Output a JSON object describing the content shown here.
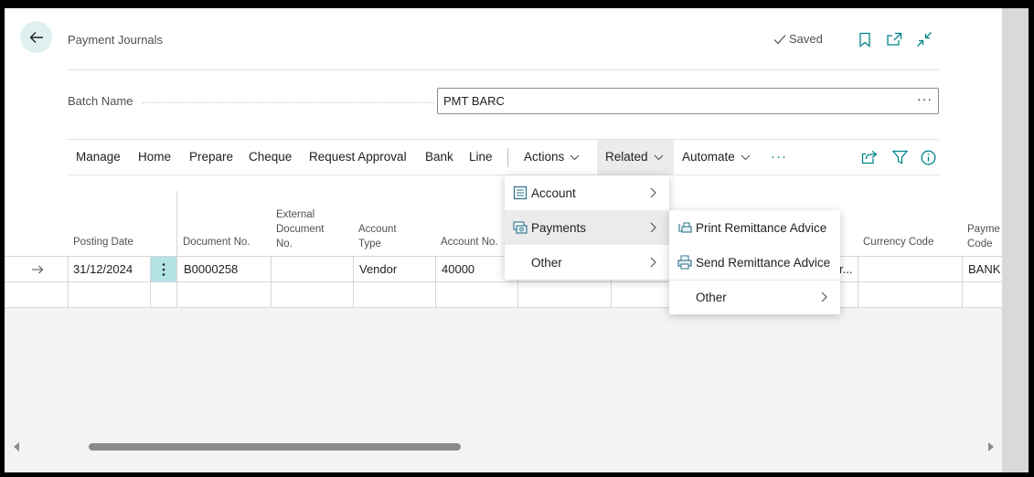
{
  "header": {
    "title": "Payment Journals",
    "saved_label": "Saved"
  },
  "batch": {
    "label": "Batch Name",
    "value": "PMT BARC",
    "more": "···"
  },
  "action_bar": {
    "items": [
      "Manage",
      "Home",
      "Prepare",
      "Cheque",
      "Request Approval",
      "Bank",
      "Line"
    ],
    "actions": "Actions",
    "related": "Related",
    "automate": "Automate",
    "more": "···"
  },
  "columns": {
    "posting_date": "Posting Date",
    "document_no": "Document No.",
    "external_1": "External",
    "external_2": "Document",
    "external_3": "No.",
    "account_type_1": "Account",
    "account_type_2": "Type",
    "account_no": "Account No.",
    "currency_code": "Currency Code",
    "payment_code_1": "Payme",
    "payment_code_2": "Code"
  },
  "row": {
    "posting_date": "31/12/2024",
    "document_no": "B0000258",
    "account_type": "Vendor",
    "account_no": "40000",
    "truncated": "r...",
    "payment_code": "BANK"
  },
  "related_menu": {
    "account": "Account",
    "payments": "Payments",
    "other": "Other"
  },
  "payments_submenu": {
    "print_remittance": "Print Remittance Advice",
    "send_remittance": "Send Remittance Advice",
    "other": "Other"
  },
  "colors": {
    "accent": "#008489",
    "selected_cell": "#b2e2e4",
    "back_button_bg": "#dff0f0"
  }
}
